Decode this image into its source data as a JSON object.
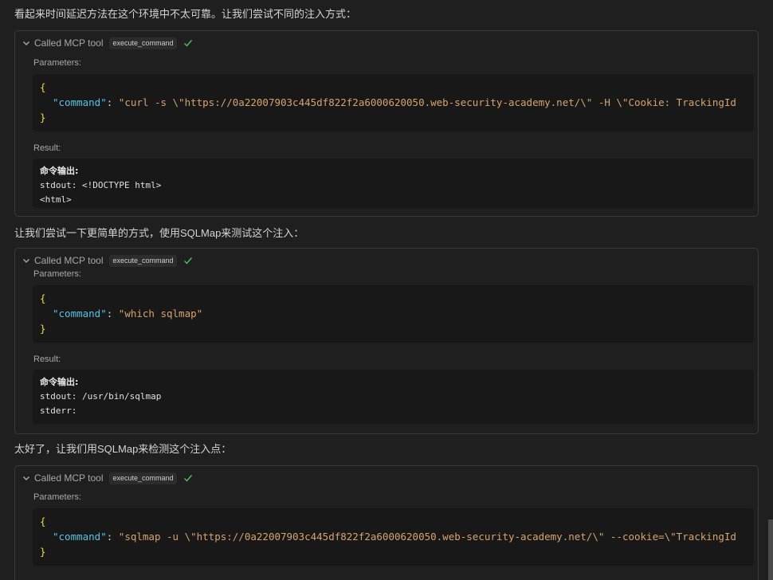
{
  "messages": [
    "看起来时间延迟方法在这个环境中不太可靠。让我们尝试不同的注入方式：",
    "让我们尝试一下更简单的方式，使用SQLMap来测试这个注入：",
    "太好了，让我们用SQLMap来检测这个注入点："
  ],
  "tool_calls": [
    {
      "header_label": "Called MCP tool",
      "tool_name": "execute_command",
      "parameters_label": "Parameters:",
      "code": {
        "open_brace": "{",
        "key": "\"command\"",
        "colon": ": ",
        "value": "\"curl -s \\\"https://0a22007903c445df822f2a6000620050.web-security-academy.net/\\\" -H \\\"Cookie: TrackingId",
        "close_brace": "}"
      },
      "result_label": "Result:",
      "result_title": "命令输出:",
      "result_lines": [
        "stdout: <!DOCTYPE html>",
        "<html>"
      ]
    },
    {
      "header_label": "Called MCP tool",
      "tool_name": "execute_command",
      "parameters_label": "Parameters:",
      "code": {
        "open_brace": "{",
        "key": "\"command\"",
        "colon": ": ",
        "value": "\"which sqlmap\"",
        "close_brace": "}"
      },
      "result_label": "Result:",
      "result_title": "命令输出:",
      "result_lines": [
        "stdout: /usr/bin/sqlmap",
        "stderr:"
      ]
    },
    {
      "header_label": "Called MCP tool",
      "tool_name": "execute_command",
      "parameters_label": "Parameters:",
      "code": {
        "open_brace": "{",
        "key": "\"command\"",
        "colon": ": ",
        "value": "\"sqlmap -u \\\"https://0a22007903c445df822f2a6000620050.web-security-academy.net/\\\" --cookie=\\\"TrackingId",
        "close_brace": "}"
      }
    }
  ],
  "colors": {
    "background": "#1f1f1f",
    "code_background": "#181818",
    "brace": "#f5d742",
    "key": "#59c2e6",
    "string": "#d7a36f",
    "check": "#4ec06a"
  },
  "icons": {
    "collapse": "chevron-down-icon",
    "status": "check-icon"
  }
}
